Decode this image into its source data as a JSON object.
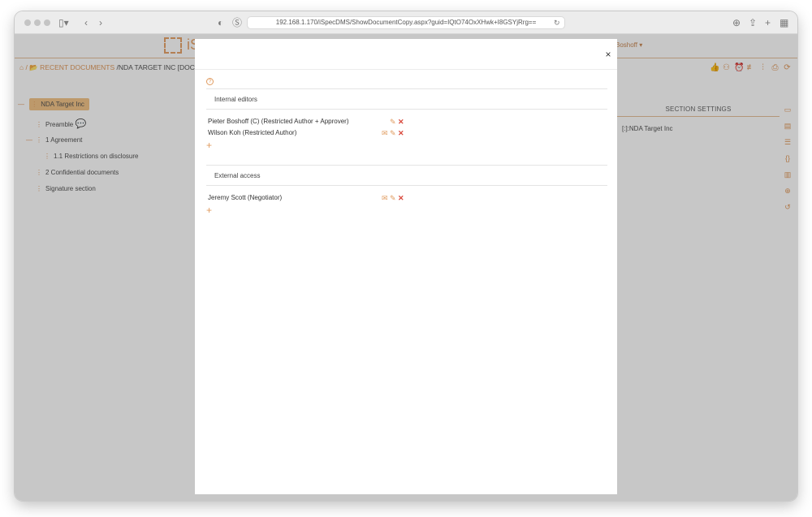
{
  "browser": {
    "url": "192.168.1.170/iSpecDMS/ShowDocumentCopy.aspx?guid=IQtO74OxXHwk+I8GSYjRrg=="
  },
  "app": {
    "logo_text": "iS",
    "user": "Boshoff ▾",
    "breadcrumb": {
      "home": "⌂",
      "recent": "/ 📂 RECENT DOCUMENTS",
      "current": "/NDA TARGET INC [DOCUME"
    },
    "tree": {
      "root": "NDA Target Inc",
      "items": [
        {
          "label": "Preamble"
        },
        {
          "label": "1 Agreement"
        },
        {
          "label": "1.1 Restrictions on disclosure"
        },
        {
          "label": "2 Confidential documents"
        },
        {
          "label": "Signature section"
        }
      ]
    },
    "section_settings": {
      "tab_label": "SECTION SETTINGS",
      "value": "[:]:NDA Target Inc"
    }
  },
  "modal": {
    "close": "×",
    "help": "?",
    "internal_editors": {
      "title": "Internal editors",
      "people": [
        {
          "name": "Pieter Boshoff (C) (Restricted Author + Approver)"
        },
        {
          "name": "Wilson Koh (Restricted Author)"
        }
      ]
    },
    "external_access": {
      "title": "External access",
      "people": [
        {
          "name": "Jeremy Scott (Negotiator)"
        }
      ]
    },
    "add_symbol": "+",
    "icons": {
      "mail": "✉",
      "edit": "✎",
      "delete": "✕"
    }
  },
  "colors": {
    "accent": "#e09b5f",
    "delete": "#d94a3d",
    "highlight": "#f3c58a"
  }
}
